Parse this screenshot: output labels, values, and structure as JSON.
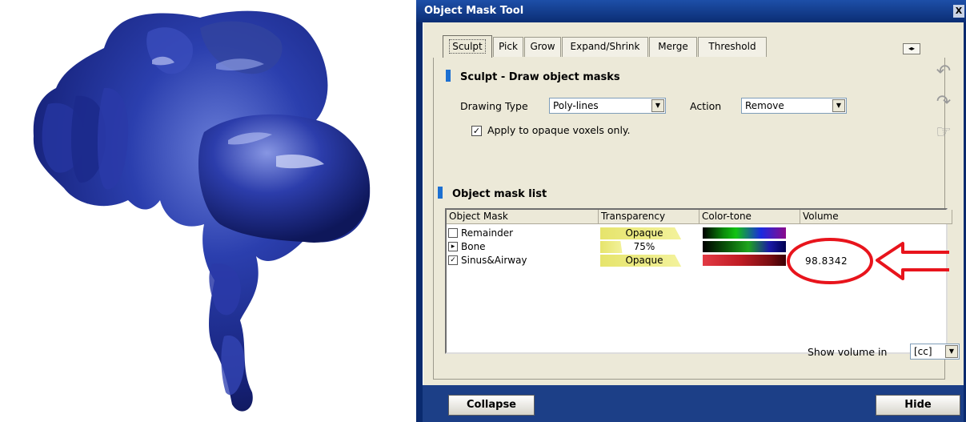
{
  "window": {
    "title": "Object Mask Tool",
    "close_glyph": "X"
  },
  "tabs": [
    {
      "label": "Sculpt",
      "active": true
    },
    {
      "label": "Pick"
    },
    {
      "label": "Grow"
    },
    {
      "label": "Expand/Shrink"
    },
    {
      "label": "Merge"
    },
    {
      "label": "Threshold"
    }
  ],
  "tab_scroll_glyph": "◂▸",
  "sculpt": {
    "heading": "Sculpt - Draw object masks",
    "drawing_type_label": "Drawing Type",
    "drawing_type_value": "Poly-lines",
    "action_label": "Action",
    "action_value": "Remove",
    "opaque_only_label": "Apply to opaque voxels only.",
    "opaque_only_checked": true
  },
  "side_buttons": [
    "undo-icon",
    "redo-icon",
    "hand-icon"
  ],
  "mask_list": {
    "heading": "Object mask list",
    "columns": [
      "Object Mask",
      "Transparency",
      "Color-tone",
      "Volume"
    ],
    "rows": [
      {
        "name": "Remainder",
        "mark": "",
        "transparency": "Opaque",
        "transparency_level": 0.92,
        "tone": "rainbow",
        "volume": ""
      },
      {
        "name": "Bone",
        "mark": "▸",
        "transparency": "75%",
        "transparency_level": 0.25,
        "tone": "greenblue",
        "volume": ""
      },
      {
        "name": "Sinus&Airway",
        "mark": "✓",
        "transparency": "Opaque",
        "transparency_level": 0.92,
        "tone": "red",
        "volume": "98.8342"
      }
    ]
  },
  "show_volume": {
    "label": "Show volume in",
    "unit": "[cc]"
  },
  "buttons": {
    "collapse": "Collapse",
    "hide": "Hide"
  },
  "annotation": {
    "color": "#e8141c"
  },
  "colors": {
    "model_blue": "#1f2f9a",
    "accent": "#1c6fd1"
  }
}
